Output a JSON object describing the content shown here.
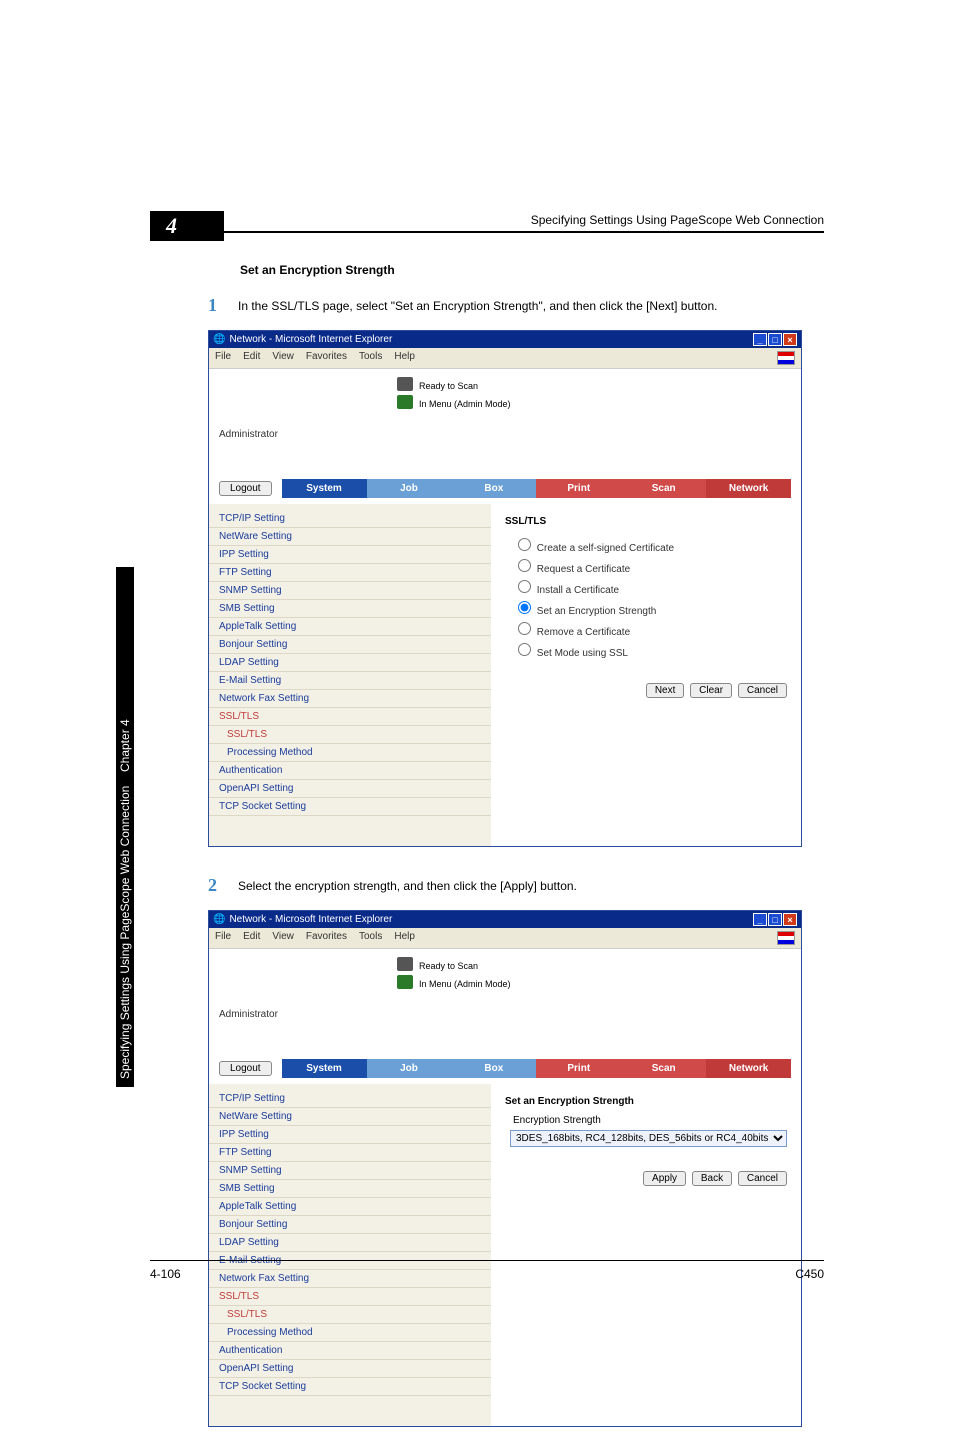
{
  "header": {
    "chapter_number": "4",
    "title": "Specifying Settings Using PageScope Web Connection"
  },
  "sidebar_tab": {
    "chapter": "Chapter 4",
    "title": "Specifying Settings Using PageScope Web Connection"
  },
  "section_heading": "Set an Encryption Strength",
  "steps": {
    "s1_num": "1",
    "s1_text": "In the SSL/TLS page, select \"Set an Encryption Strength\", and then click the [Next] button.",
    "s2_num": "2",
    "s2_text": "Select the encryption strength, and then click the [Apply] button."
  },
  "browser": {
    "window_title": "Network - Microsoft Internet Explorer",
    "menus": [
      "File",
      "Edit",
      "View",
      "Favorites",
      "Tools",
      "Help"
    ],
    "win_min": "_",
    "win_max": "□",
    "win_close": "×",
    "ready": "Ready to Scan",
    "in_menu": "In Menu (Admin Mode)",
    "admin_label": "Administrator",
    "logout": "Logout",
    "tabs": {
      "system": "System",
      "job": "Job",
      "box": "Box",
      "print": "Print",
      "scan": "Scan",
      "network": "Network"
    }
  },
  "nav_items": [
    "TCP/IP Setting",
    "NetWare Setting",
    "IPP Setting",
    "FTP Setting",
    "SNMP Setting",
    "SMB Setting",
    "AppleTalk Setting",
    "Bonjour Setting",
    "LDAP Setting",
    "E-Mail Setting",
    "Network Fax Setting",
    "SSL/TLS",
    "SSL/TLS",
    "Processing Method",
    "Authentication",
    "OpenAPI Setting",
    "TCP Socket Setting"
  ],
  "panel1": {
    "title": "SSL/TLS",
    "options": [
      "Create a self-signed Certificate",
      "Request a Certificate",
      "Install a Certificate",
      "Set an Encryption Strength",
      "Remove a Certificate",
      "Set Mode using SSL"
    ],
    "selected_index": 3,
    "buttons": {
      "next": "Next",
      "clear": "Clear",
      "cancel": "Cancel"
    }
  },
  "panel2": {
    "title": "Set an Encryption Strength",
    "row_label": "Encryption Strength",
    "select_value": "3DES_168bits, RC4_128bits, DES_56bits or RC4_40bits",
    "buttons": {
      "apply": "Apply",
      "back": "Back",
      "cancel": "Cancel"
    }
  },
  "footer": {
    "left": "4-106",
    "right": "C450"
  }
}
